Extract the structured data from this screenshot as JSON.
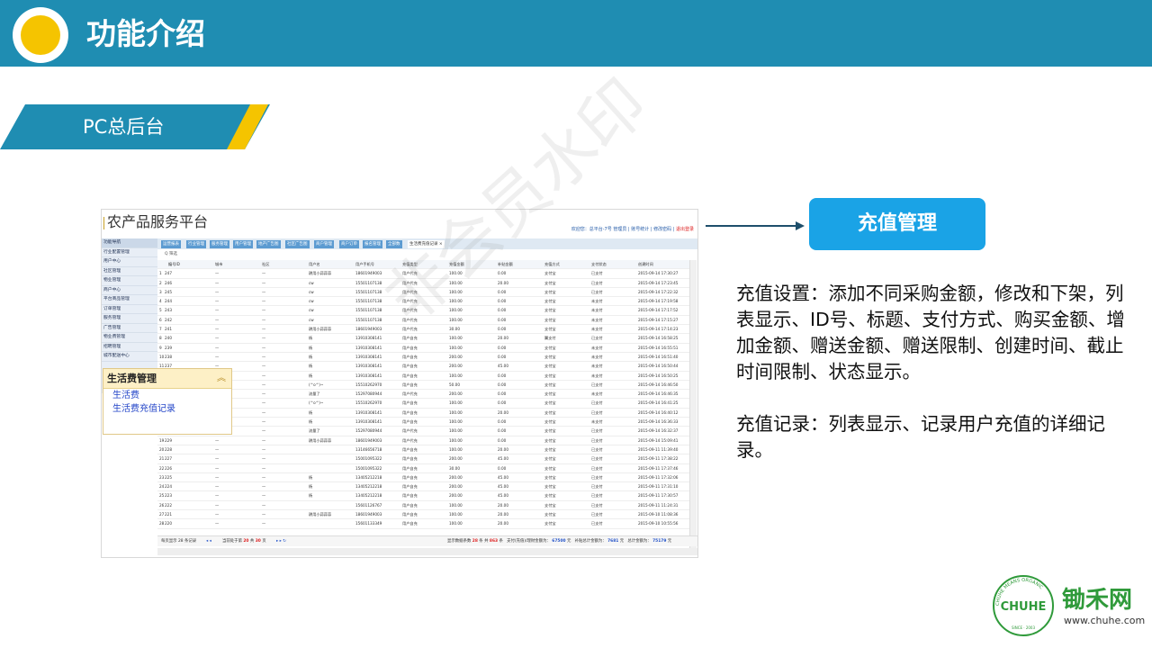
{
  "header": {
    "title": "功能介绍"
  },
  "section": {
    "label": "PC总后台"
  },
  "screenshot": {
    "app_title": "农产品服务平台",
    "top_links": {
      "welcome": "欢迎您：总平台-7号 管理员",
      "link1": "账号统计",
      "link2": "修改密码",
      "logout": "退出登录"
    },
    "sidebar": [
      "功能导航",
      "行业配置管理",
      "用户中心",
      "社区管理",
      "物业管理",
      "商户中心",
      "平台商品管理",
      "订单管理",
      "服务管理",
      "广告管理",
      "物业费管理",
      "招聘管理",
      "城市配送中心"
    ],
    "tabs": [
      "运营报表",
      "行业管理",
      "服务管理",
      "用户管理",
      "地产广告图",
      "社区广告图",
      "商户管理",
      "商户订单",
      "报名管理",
      "全部数",
      "生活费充值记录 ×"
    ],
    "filter": "Q 筛选",
    "columns": [
      "编号ID",
      "城市",
      "社区",
      "用户名",
      "用户手机号",
      "充值类型",
      "充值金额",
      "补贴金额",
      "充值方式",
      "支付状态",
      "创建时间"
    ],
    "rows": [
      [
        "1",
        "247",
        "—",
        "—",
        "耕用小蒜蒜蒜",
        "18601949003",
        "用户代充",
        "100.00",
        "0.00",
        "支付宝",
        "已支付",
        "2015-09-14 17:30:27"
      ],
      [
        "2",
        "246",
        "—",
        "—",
        "cw",
        "15501107138",
        "用户代充",
        "100.00",
        "20.00",
        "支付宝",
        "已支付",
        "2015-09-14 17:23:45"
      ],
      [
        "3",
        "245",
        "—",
        "—",
        "cw",
        "15501107138",
        "用户代充",
        "100.00",
        "0.00",
        "支付宝",
        "已支付",
        "2015-09-14 17:22:32"
      ],
      [
        "4",
        "244",
        "—",
        "—",
        "cw",
        "15501107138",
        "用户代充",
        "100.00",
        "0.00",
        "支付宝",
        "未支付",
        "2015-09-14 17:19:58"
      ],
      [
        "5",
        "243",
        "—",
        "—",
        "cw",
        "15501107138",
        "用户代充",
        "100.00",
        "0.00",
        "支付宝",
        "未支付",
        "2015-09-14 17:17:52"
      ],
      [
        "6",
        "242",
        "—",
        "—",
        "cw",
        "15501107138",
        "用户代充",
        "100.00",
        "0.00",
        "支付宝",
        "未支付",
        "2015-09-14 17:15:27"
      ],
      [
        "7",
        "241",
        "—",
        "—",
        "耕用小蒜蒜蒜",
        "18601949003",
        "用户代充",
        "30.00",
        "0.00",
        "支付宝",
        "未支付",
        "2015-09-14 17:14:23"
      ],
      [
        "8",
        "240",
        "—",
        "—",
        "杨",
        "13910308141",
        "用户自充",
        "100.00",
        "20.00",
        "翼支付",
        "已支付",
        "2015-09-14 16:58:25"
      ],
      [
        "9",
        "239",
        "—",
        "—",
        "杨",
        "13910308141",
        "用户自充",
        "100.00",
        "0.00",
        "支付宝",
        "未支付",
        "2015-09-14 16:55:51"
      ],
      [
        "10",
        "238",
        "—",
        "—",
        "杨",
        "13910308141",
        "用户自充",
        "200.00",
        "0.00",
        "支付宝",
        "未支付",
        "2015-09-14 16:51:40"
      ],
      [
        "11",
        "237",
        "—",
        "—",
        "杨",
        "13910308141",
        "用户自充",
        "200.00",
        "45.00",
        "支付宝",
        "未支付",
        "2015-09-14 16:50:44"
      ],
      [
        "12",
        "236",
        "—",
        "—",
        "杨",
        "13910308141",
        "用户自充",
        "100.00",
        "0.00",
        "支付宝",
        "未支付",
        "2015-09-14 16:50:25"
      ],
      [
        "13",
        "235",
        "—",
        "—",
        "(^o^)~",
        "15510262970",
        "用户自充",
        "50.00",
        "0.00",
        "支付宝",
        "已支付",
        "2015-09-14 16:46:50"
      ],
      [
        "14",
        "234",
        "—",
        "—",
        "流量了",
        "15297080944",
        "用户代充",
        "200.00",
        "0.00",
        "支付宝",
        "未支付",
        "2015-09-14 16:46:35"
      ],
      [
        "15",
        "233",
        "—",
        "—",
        "(^o^)~",
        "15510262970",
        "用户自充",
        "100.00",
        "0.00",
        "支付宝",
        "已支付",
        "2015-09-14 16:41:25"
      ],
      [
        "16",
        "232",
        "—",
        "—",
        "杨",
        "13910308141",
        "用户自充",
        "100.00",
        "20.00",
        "支付宝",
        "已支付",
        "2015-09-14 16:40:12"
      ],
      [
        "17",
        "231",
        "—",
        "—",
        "杨",
        "13910308141",
        "用户自充",
        "100.00",
        "0.00",
        "支付宝",
        "未支付",
        "2015-09-14 16:36:33"
      ],
      [
        "18",
        "230",
        "—",
        "—",
        "流量了",
        "15297080944",
        "用户代充",
        "100.00",
        "0.00",
        "支付宝",
        "已支付",
        "2015-09-14 16:32:37"
      ],
      [
        "19",
        "229",
        "—",
        "—",
        "耕用小蒜蒜蒜",
        "18601949003",
        "用户代充",
        "100.00",
        "0.00",
        "支付宝",
        "已支付",
        "2015-09-14 15:09:41"
      ],
      [
        "20",
        "228",
        "—",
        "—",
        "",
        "13146656718",
        "用户自充",
        "100.00",
        "20.00",
        "支付宝",
        "已支付",
        "2015-09-11 11:39:40"
      ],
      [
        "21",
        "227",
        "—",
        "—",
        "",
        "15001095322",
        "用户自充",
        "200.00",
        "45.00",
        "支付宝",
        "已支付",
        "2015-09-11 17:38:22"
      ],
      [
        "22",
        "226",
        "—",
        "—",
        "",
        "15001095322",
        "用户自充",
        "30.00",
        "0.00",
        "支付宝",
        "已支付",
        "2015-09-11 17:37:46"
      ],
      [
        "23",
        "225",
        "—",
        "—",
        "杨",
        "13405212218",
        "用户自充",
        "200.00",
        "45.00",
        "支付宝",
        "已支付",
        "2015-09-11 17:32:06"
      ],
      [
        "24",
        "224",
        "—",
        "—",
        "杨",
        "13405212218",
        "用户自充",
        "200.00",
        "45.00",
        "支付宝",
        "已支付",
        "2015-09-11 17:31:10"
      ],
      [
        "25",
        "223",
        "—",
        "—",
        "杨",
        "13405212218",
        "用户自充",
        "200.00",
        "45.00",
        "支付宝",
        "已支付",
        "2015-09-11 17:30:57"
      ],
      [
        "26",
        "222",
        "—",
        "—",
        "",
        "15601126767",
        "用户自充",
        "100.00",
        "20.00",
        "支付宝",
        "已支付",
        "2015-09-11 11:24:31"
      ],
      [
        "27",
        "221",
        "—",
        "—",
        "耕用小蒜蒜蒜",
        "18601949003",
        "用户自充",
        "100.00",
        "20.00",
        "支付宝",
        "已支付",
        "2015-09-10 11:08:36"
      ],
      [
        "28",
        "220",
        "—",
        "—",
        "",
        "15601133349",
        "用户自充",
        "100.00",
        "20.00",
        "支付宝",
        "已支付",
        "2015-09-10 10:55:56"
      ]
    ],
    "pager": {
      "per_page": "每页显示 28 条记录",
      "current_prefix": "当前处于第",
      "current_page": "20",
      "total_prefix": "共",
      "total_pages": "30",
      "page_suffix": "页",
      "summary_prefix": "显示数据条数",
      "shown": "28",
      "summary_mid": "条 共",
      "total": "863",
      "summary_suffix": "条",
      "alipay_label": "支付(充值)/理财金额为：",
      "alipay_value": "67500",
      "alipay_unit": "元",
      "subsidy_label": "补贴总计金额为：",
      "subsidy_value": "7681",
      "subsidy_unit": "元",
      "sum_label": "总计金额为：",
      "sum_value": "75179",
      "sum_unit": "元"
    },
    "popup": {
      "title": "生活费管理",
      "link1": "生活费",
      "link2": "生活费充值记录"
    },
    "watermark": "非会员水印"
  },
  "action_button": "充值管理",
  "description": {
    "p1": "充值设置：添加不同采购金额，修改和下架，列表显示、ID号、标题、支付方式、购买金额、增加金额、赠送金额、赠送限制、创建时间、截止时间限制、状态显示。",
    "p2": "充值记录：列表显示、记录用户充值的详细记录。"
  },
  "brand": {
    "name": "锄禾网",
    "url": "www.chuhe.com",
    "logo_text": "CHUHE",
    "ring_text": "CHUHE MEANS ORGANIC",
    "since": "SINCE · 2003"
  },
  "colors": {
    "primary": "#1f8db2",
    "accent": "#f5c400",
    "button": "#1aa3e6",
    "brand_green": "#2f9a3a"
  }
}
